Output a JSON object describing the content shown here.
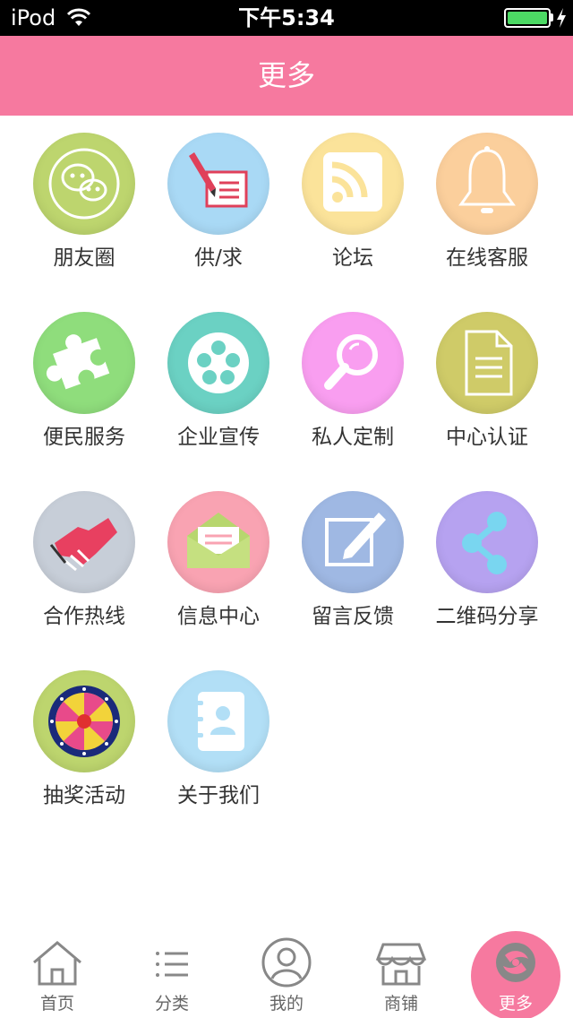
{
  "status": {
    "carrier": "iPod",
    "time": "下午5:34",
    "battery_level": 1.0
  },
  "header": {
    "title": "更多"
  },
  "grid": [
    {
      "label": "朋友圈",
      "icon": "wechat-moments-icon",
      "color": "#bdd56e"
    },
    {
      "label": "供/求",
      "icon": "pen-document-icon",
      "color": "#a9d9f5"
    },
    {
      "label": "论坛",
      "icon": "rss-icon",
      "color": "#fbe39a"
    },
    {
      "label": "在线客服",
      "icon": "bell-icon",
      "color": "#fbcf9c"
    },
    {
      "label": "便民服务",
      "icon": "puzzle-icon",
      "color": "#8fdd7c"
    },
    {
      "label": "企业宣传",
      "icon": "film-reel-icon",
      "color": "#6bd1c3"
    },
    {
      "label": "私人定制",
      "icon": "magnifier-icon",
      "color": "#f99ef0"
    },
    {
      "label": "中心认证",
      "icon": "document-icon",
      "color": "#cfcb68"
    },
    {
      "label": "合作热线",
      "icon": "handshake-icon",
      "color": "#c7ced8"
    },
    {
      "label": "信息中心",
      "icon": "envelope-icon",
      "color": "#f9a3b2"
    },
    {
      "label": "留言反馈",
      "icon": "edit-note-icon",
      "color": "#9fb8e3"
    },
    {
      "label": "二维码分享",
      "icon": "share-icon",
      "color": "#b6a2f0"
    },
    {
      "label": "抽奖活动",
      "icon": "prize-wheel-icon",
      "color": "#bdd56e"
    },
    {
      "label": "关于我们",
      "icon": "contact-book-icon",
      "color": "#b2dff6"
    }
  ],
  "tabbar": [
    {
      "label": "首页",
      "icon": "home-icon"
    },
    {
      "label": "分类",
      "icon": "list-icon"
    },
    {
      "label": "我的",
      "icon": "user-icon"
    },
    {
      "label": "商铺",
      "icon": "shop-icon"
    },
    {
      "label": "更多",
      "icon": "more-icon",
      "active": true
    }
  ],
  "colors": {
    "accent": "#f6799f",
    "battery": "#4cd964"
  }
}
